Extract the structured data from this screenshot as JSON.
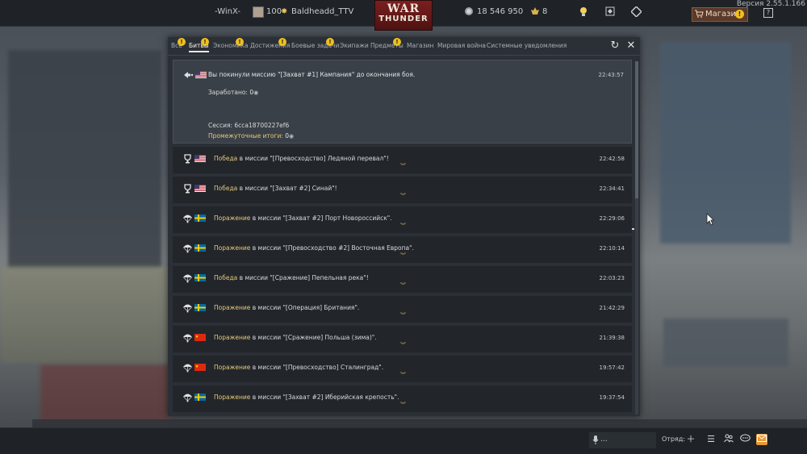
{
  "version": "Версия 2.55.1.166",
  "topbar": {
    "user_left": "-WinX-",
    "rank": "100",
    "username": "Baldheadd_TTV",
    "logo_line1": "WAR",
    "logo_line2": "THUNDER",
    "silver_lions": "18 546 950",
    "golden_eagles": "8",
    "shop_label": "Магазин",
    "shop_badge": "!",
    "help_label": "?"
  },
  "tabs": [
    {
      "label": "Все",
      "badge": "!"
    },
    {
      "label": "Битвы",
      "badge": "!",
      "active": true
    },
    {
      "label": "Экономика",
      "badge": "!"
    },
    {
      "label": "Достижения",
      "badge": "!"
    },
    {
      "label": "Боевые задачи",
      "badge": "!"
    },
    {
      "label": "Экипажи",
      "badge": ""
    },
    {
      "label": "Предметы",
      "badge": "!"
    },
    {
      "label": "Магазин",
      "badge": ""
    },
    {
      "label": "Мировая война",
      "badge": ""
    },
    {
      "label": "Системные уведомления",
      "badge": ""
    }
  ],
  "expanded_message": {
    "text": "Вы покинули миссию \"[Захват #1] Кампания\" до окончания боя.",
    "time": "22:43:57",
    "earned_label": "Заработано:",
    "earned_value": "0",
    "session_label": "Сессия: 6cca18700227ef6",
    "intermediate_label": "Промежуточные итоги:",
    "intermediate_value": "0",
    "flag": "usa",
    "icon": "arrow-icon"
  },
  "messages": [
    {
      "icon": "trophy-icon",
      "flag": "usa",
      "result": "Победа",
      "text": " в миссии \"[Превосходство] Ледяной перевал\"!",
      "time": "22:42:58"
    },
    {
      "icon": "trophy-icon",
      "flag": "usa",
      "result": "Победа",
      "text": " в миссии \"[Захват #2] Синай\"!",
      "time": "22:34:41"
    },
    {
      "icon": "parachute-icon",
      "flag": "sweden",
      "result": "Поражение",
      "text": " в миссии \"[Захват #2] Порт Новороссийск\".",
      "time": "22:29:06"
    },
    {
      "icon": "parachute-icon",
      "flag": "sweden",
      "result": "Поражение",
      "text": " в миссии \"[Превосходство #2] Восточная Европа\".",
      "time": "22:10:14"
    },
    {
      "icon": "parachute-icon",
      "flag": "sweden",
      "result": "Победа",
      "text": " в миссии \"[Сражение] Пепельная река\"!",
      "time": "22:03:23"
    },
    {
      "icon": "parachute-icon",
      "flag": "sweden",
      "result": "Поражение",
      "text": " в миссии \"[Операция] Британия\".",
      "time": "21:42:29"
    },
    {
      "icon": "parachute-icon",
      "flag": "china",
      "result": "Поражение",
      "text": " в миссии \"[Сражение] Польша (зима)\".",
      "time": "21:39:38"
    },
    {
      "icon": "parachute-icon",
      "flag": "china",
      "result": "Поражение",
      "text": " в миссии \"[Превосходство] Сталинград\".",
      "time": "19:57:42"
    },
    {
      "icon": "parachute-icon",
      "flag": "sweden",
      "result": "Поражение",
      "text": " в миссии \"[Захват #2] Иберийская крепость\".",
      "time": "19:37:54"
    }
  ],
  "bottombar": {
    "chat_label": "...",
    "squad_label": "Отряд:"
  },
  "colors": {
    "accent_gold": "#e8c87a",
    "badge_yellow": "#f0c020",
    "panel_bg": "#2b3036"
  }
}
